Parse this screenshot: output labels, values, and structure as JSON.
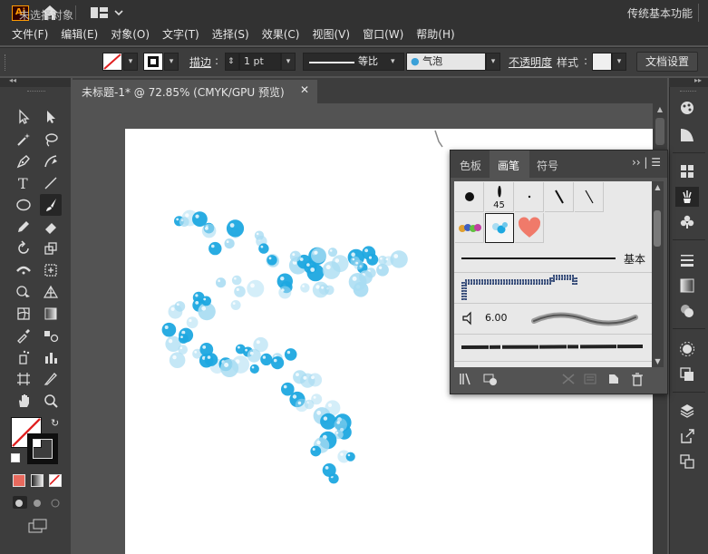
{
  "app": {
    "logo_text": "Ai",
    "workspace": "传统基本功能"
  },
  "menu": [
    "文件(F)",
    "编辑(E)",
    "对象(O)",
    "文字(T)",
    "选择(S)",
    "效果(C)",
    "视图(V)",
    "窗口(W)",
    "帮助(H)"
  ],
  "control_bar": {
    "selection_status": "未选择对象",
    "stroke_label": "描边",
    "stroke_value": "1 pt",
    "profile_label": "等比",
    "brush_name": "气泡",
    "opacity_label": "不透明度",
    "style_label": "样式",
    "doc_setup_button": "文档设置"
  },
  "document": {
    "tab_title": "未标题-1* @ 72.85% (CMYK/GPU 预览)",
    "close_glyph": "✕"
  },
  "brush_panel": {
    "tabs": [
      "色板",
      "画笔",
      "符号"
    ],
    "active_tab": "画笔",
    "menu_glyph": "››  |  ☰",
    "calligraphic_size": "45",
    "basic_label": "基本",
    "bristle_size": "6.00"
  },
  "colors": {
    "accent_bubble_dark": "#1ea8e0",
    "accent_bubble_light": "#a8dcf2",
    "heart": "#f07a6a",
    "ai_orange": "#ff9a00"
  },
  "icons": [
    "home-icon",
    "workspace-switcher-icon",
    "selection-tool-icon",
    "direct-selection-tool-icon",
    "magic-wand-icon",
    "lasso-icon",
    "pen-icon",
    "curvature-icon",
    "type-icon",
    "line-icon",
    "ellipse-icon",
    "paintbrush-icon",
    "pencil-icon",
    "eraser-icon",
    "rotate-icon",
    "scale-icon",
    "width-icon",
    "free-transform-icon",
    "shape-builder-icon",
    "perspective-grid-icon",
    "mesh-icon",
    "gradient-icon",
    "eyedropper-icon",
    "blend-icon",
    "symbol-sprayer-icon",
    "graph-icon",
    "artboard-icon",
    "slice-icon",
    "hand-icon",
    "zoom-icon"
  ]
}
